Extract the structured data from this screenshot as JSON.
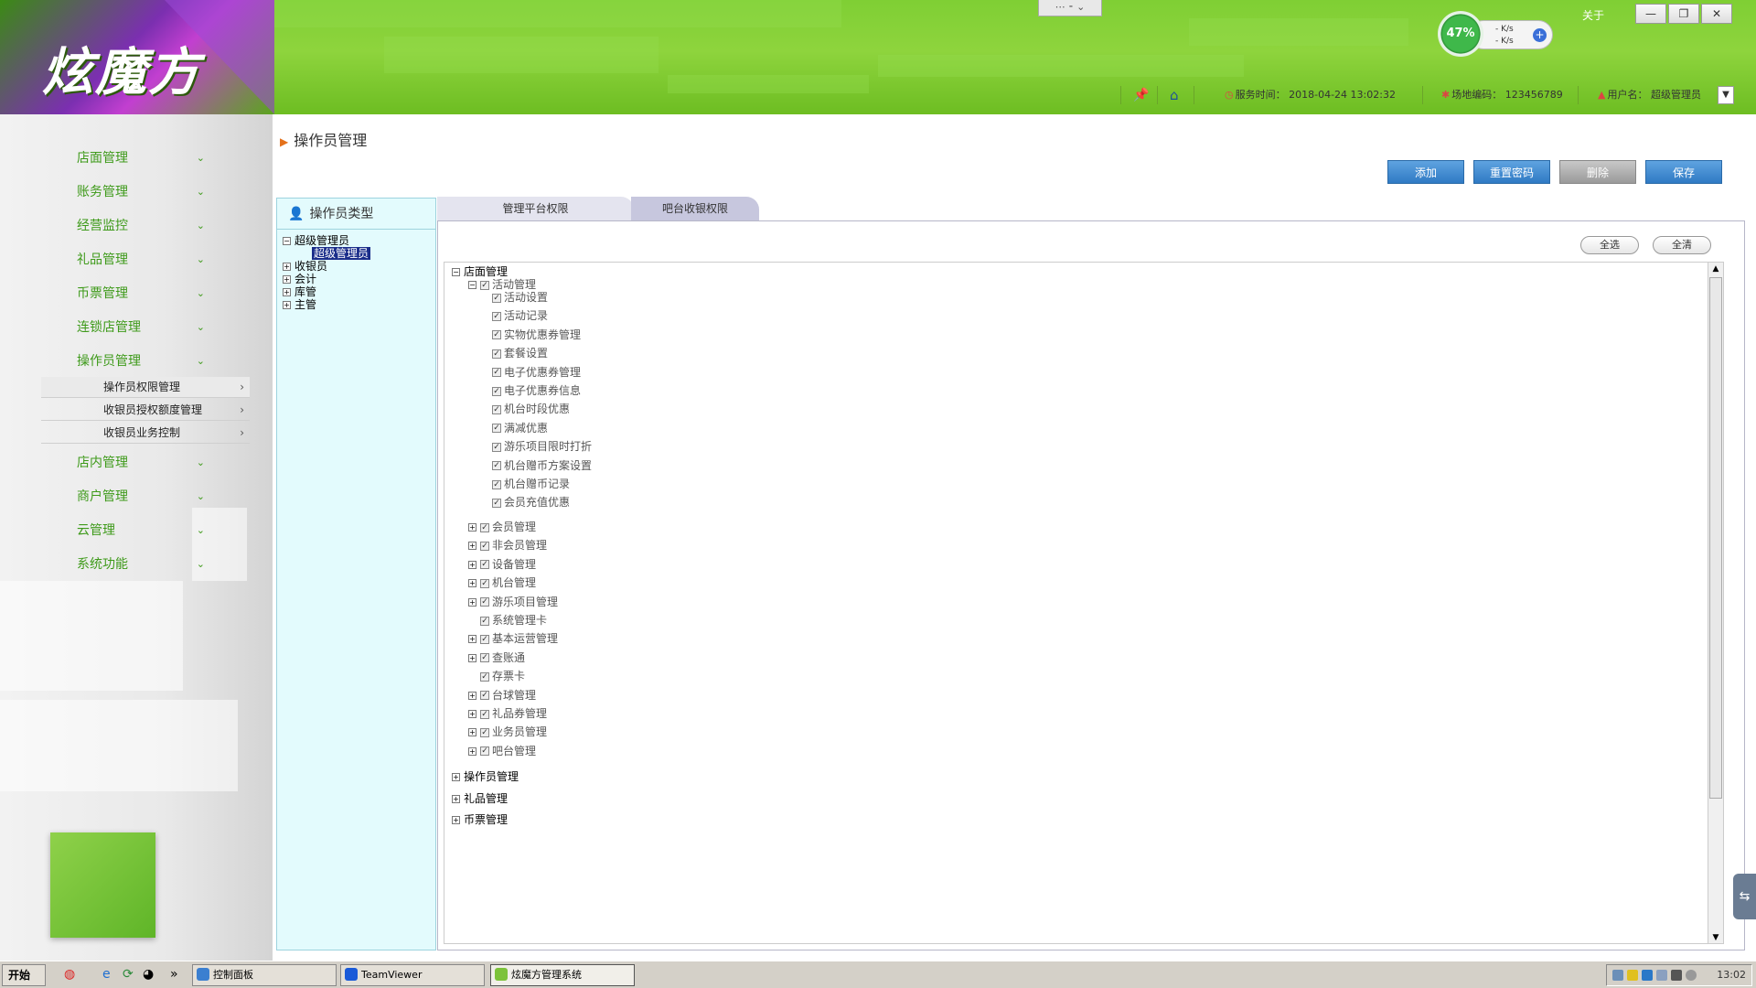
{
  "header": {
    "logo_text": "炫魔方",
    "about": "关于",
    "speed": {
      "percent": "47%",
      "up": "- K/s",
      "down": "- K/s",
      "plus": "+"
    },
    "window_controls": {
      "minimize": "—",
      "restore": "❐",
      "close": "✕"
    },
    "server_time_label": "服务时间：",
    "server_time": "2018-04-24 13:02:32",
    "site_code_label": "场地编码：",
    "site_code": "123456789",
    "user_label": "用户名：",
    "user_name": "超级管理员"
  },
  "sidebar": {
    "items": [
      {
        "label": "店面管理"
      },
      {
        "label": "账务管理"
      },
      {
        "label": "经营监控"
      },
      {
        "label": "礼品管理"
      },
      {
        "label": "币票管理"
      },
      {
        "label": "连锁店管理"
      },
      {
        "label": "操作员管理"
      },
      {
        "label": "店内管理"
      },
      {
        "label": "商户管理"
      },
      {
        "label": "云管理"
      },
      {
        "label": "系统功能"
      }
    ],
    "sub_items": [
      {
        "label": "操作员权限管理"
      },
      {
        "label": "收银员授权额度管理"
      },
      {
        "label": "收银员业务控制"
      }
    ]
  },
  "page": {
    "title": "操作员管理",
    "buttons": {
      "add": "添加",
      "reset_password": "重置密码",
      "delete": "删除",
      "save": "保存"
    }
  },
  "operator_types": {
    "title": "操作员类型",
    "tree": [
      {
        "label": "超级管理员",
        "expanded": true,
        "children": [
          {
            "label": "超级管理员",
            "selected": true
          }
        ]
      },
      {
        "label": "收银员"
      },
      {
        "label": "会计"
      },
      {
        "label": "库管"
      },
      {
        "label": "主管"
      }
    ]
  },
  "tabs": [
    {
      "label": "管理平台权限",
      "active": true
    },
    {
      "label": "吧台收银权限",
      "active": false
    }
  ],
  "permissions": {
    "select_all": "全选",
    "clear_all": "全清",
    "root": "店面管理",
    "activity": {
      "label": "活动管理",
      "children": [
        "活动设置",
        "活动记录",
        "实物优惠券管理",
        "套餐设置",
        "电子优惠券管理",
        "电子优惠券信息",
        "机台时段优惠",
        "满减优惠",
        "游乐项目限时打折",
        "机台赠币方案设置",
        "机台赠币记录",
        "会员充值优惠"
      ]
    },
    "groups": [
      {
        "label": "会员管理",
        "expandable": true
      },
      {
        "label": "非会员管理",
        "expandable": true
      },
      {
        "label": "设备管理",
        "expandable": true
      },
      {
        "label": "机台管理",
        "expandable": true
      },
      {
        "label": "游乐项目管理",
        "expandable": true
      },
      {
        "label": "系统管理卡",
        "expandable": false
      },
      {
        "label": "基本运营管理",
        "expandable": true
      },
      {
        "label": "查账通",
        "expandable": true
      },
      {
        "label": "存票卡",
        "expandable": false
      },
      {
        "label": "台球管理",
        "expandable": true
      },
      {
        "label": "礼品券管理",
        "expandable": true
      },
      {
        "label": "业务员管理",
        "expandable": true
      },
      {
        "label": "吧台管理",
        "expandable": true
      }
    ],
    "top_level": [
      "操作员管理",
      "礼品管理",
      "币票管理"
    ]
  },
  "taskbar": {
    "start": "开始",
    "tasks": [
      {
        "label": "控制面板",
        "active": false
      },
      {
        "label": "TeamViewer",
        "active": false
      },
      {
        "label": "炫魔方管理系统",
        "active": true
      }
    ],
    "clock": "13:02"
  },
  "colors": {
    "header_green": "#7fcf34",
    "menu_green": "#3e9a1a",
    "button_blue": "#2f7ac4",
    "selection": "#1a2d8a"
  }
}
